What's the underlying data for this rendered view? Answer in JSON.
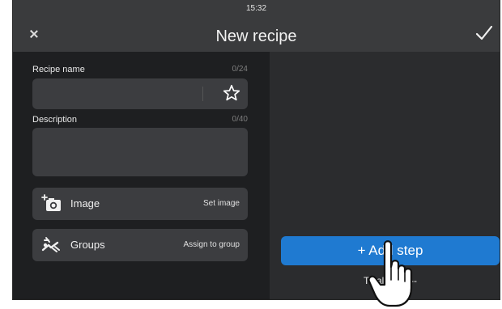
{
  "status_bar": {
    "time": "15:32"
  },
  "header": {
    "title": "New recipe"
  },
  "form": {
    "recipe_name": {
      "label": "Recipe name",
      "counter": "0/24",
      "value": ""
    },
    "description": {
      "label": "Description",
      "counter": "0/40",
      "value": ""
    }
  },
  "rows": {
    "image": {
      "label": "Image",
      "action": "Set image",
      "icon": "add-photo-icon"
    },
    "groups": {
      "label": "Groups",
      "action": "Assign to group",
      "icon": "groups-icon"
    }
  },
  "actions": {
    "add_step_label": "+ Add step"
  },
  "footer": {
    "total_time": "Total time: --"
  },
  "colors": {
    "accent": "#1f7ad1",
    "panel_dark": "#1e1f21",
    "panel": "#2b2c2e",
    "field": "#3c3d40"
  }
}
